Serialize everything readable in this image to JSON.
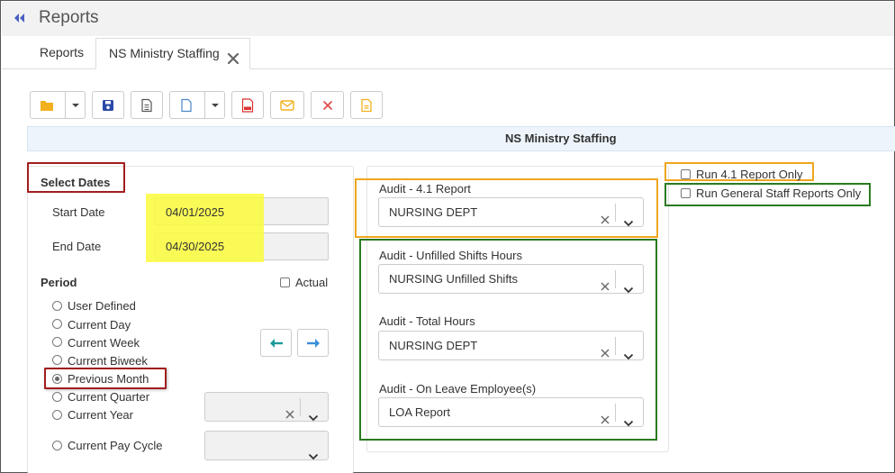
{
  "header": {
    "title": "Reports"
  },
  "tabs": [
    {
      "label": "Reports"
    },
    {
      "label": "NS Ministry Staffing"
    }
  ],
  "toolbar": {
    "buttons": [
      "folder-icon",
      "save-icon",
      "document-icon",
      "new-document-icon",
      "pdf-icon",
      "mail-icon",
      "delete-icon",
      "note-icon"
    ],
    "colors": {
      "folder": "#f2b01e",
      "save": "#2b4aa8",
      "pdf": "#d9332e",
      "mail": "#f2b01e",
      "delete": "#e04b4b",
      "note": "#f2b01e"
    }
  },
  "section": {
    "title": "NS Ministry Staffing"
  },
  "dates": {
    "heading": "Select Dates",
    "start_label": "Start Date",
    "start_value": "04/01/2025",
    "end_label": "End Date",
    "end_value": "04/30/2025"
  },
  "period": {
    "label": "Period",
    "actual_label": "Actual",
    "options": [
      {
        "label": "User Defined",
        "selected": false
      },
      {
        "label": "Current Day",
        "selected": false
      },
      {
        "label": "Current Week",
        "selected": false
      },
      {
        "label": "Current Biweek",
        "selected": false
      },
      {
        "label": "Previous Month",
        "selected": true
      },
      {
        "label": "Current Quarter",
        "selected": false
      },
      {
        "label": "Current Year",
        "selected": false
      },
      {
        "label": "Current Pay Cycle",
        "selected": false
      }
    ]
  },
  "audits": [
    {
      "label": "Audit - 4.1 Report",
      "value": "NURSING DEPT"
    },
    {
      "label": "Audit - Unfilled Shifts Hours",
      "value": "NURSING Unfilled Shifts"
    },
    {
      "label": "Audit - Total Hours",
      "value": "NURSING DEPT"
    },
    {
      "label": "Audit - On Leave Employee(s)",
      "value": "LOA Report"
    }
  ],
  "options": {
    "run41": "Run 4.1 Report Only",
    "run_general": "Run General Staff Reports Only"
  },
  "annotation_colors": {
    "yellow": "#fbfb3c",
    "red": "#a11d1d",
    "orange": "#f0a61e",
    "green": "#2a7a1f"
  }
}
